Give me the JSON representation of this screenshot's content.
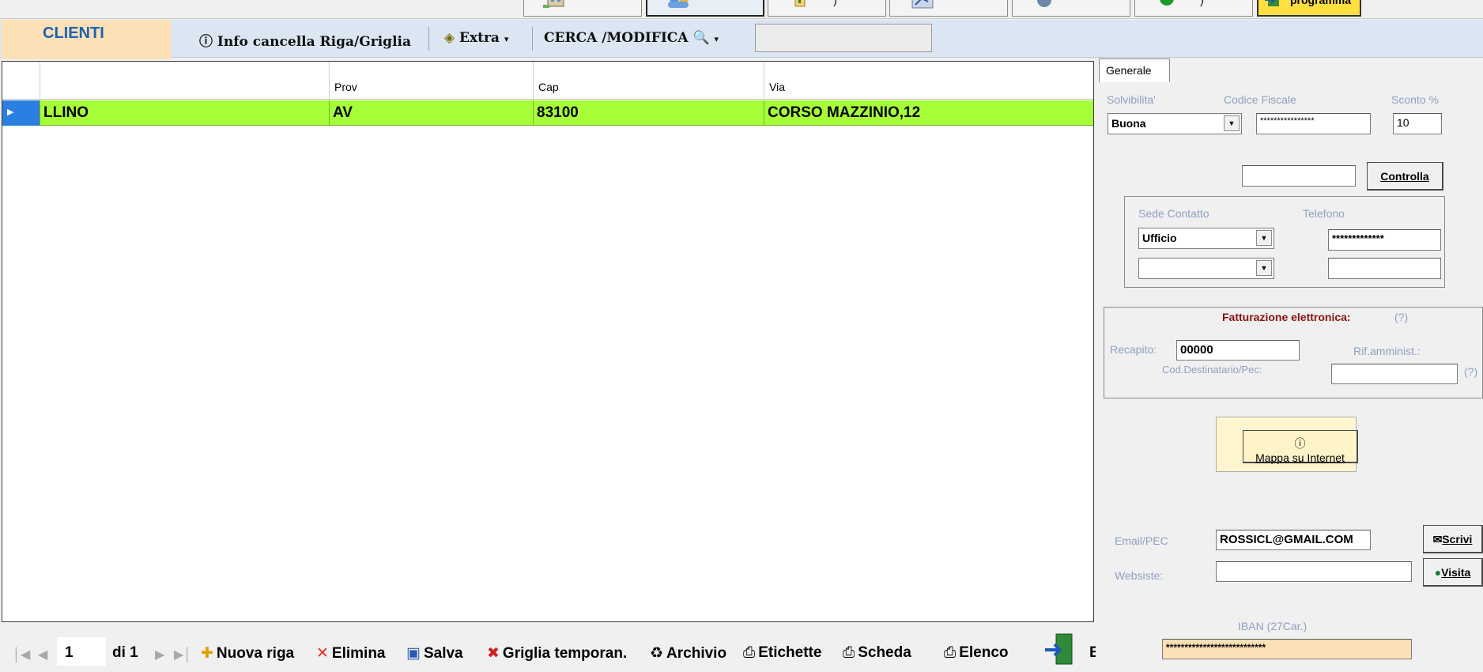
{
  "top_buttons": {
    "exit_label": "programma"
  },
  "toolbar": {
    "tab_label": "CLIENTI",
    "info_label": "Info cancella Riga/Griglia",
    "extra_label": "Extra",
    "search_label": "CERCA /MODIFICA",
    "search_value": ""
  },
  "grid": {
    "columns": [
      "",
      "Prov",
      "Cap",
      "Via"
    ],
    "rows": [
      {
        "name": "LLINO",
        "prov": "AV",
        "cap": "83100",
        "via": "CORSO MAZZINIO,12"
      }
    ]
  },
  "bottom_bar": {
    "position": "1",
    "of_label": "di 1",
    "new_row": "Nuova riga",
    "delete": "Elimina",
    "save": "Salva",
    "temp_grid": "Griglia temporan.",
    "archive": "Archivio",
    "labels": "Etichette",
    "card": "Scheda",
    "list": "Elenco",
    "exit": "Esci"
  },
  "panel": {
    "tab": "Generale",
    "solvibilita_label": "Solvibilita'",
    "solvibilita_value": "Buona",
    "codice_fiscale_label": "Codice Fiscale",
    "codice_fiscale_value": "****************",
    "sconto_label": "Sconto %",
    "sconto_value": "10",
    "controlla_label": "Controlla",
    "sede_contatto_label": "Sede Contatto",
    "sede_value": "Ufficio",
    "telefono_label": "Telefono",
    "telefono_value": "*************",
    "fatturazione_label": "Fatturazione elettronica:",
    "help_q": "(?)",
    "recapito_label": "Recapito:",
    "recapito_value": "00000",
    "rif_label": "Rif.amminist.:",
    "cod_dest_label": "Cod.Destinatario/Pec:",
    "mappa_label": "Mappa su Internet",
    "email_label": "Email/PEC",
    "email_value": "ROSSICL@GMAIL.COM",
    "scrivi_label": "Scrivi",
    "website_label": "Websiste:",
    "visita_label": "Visita",
    "iban_label": "IBAN (27Car.)",
    "iban_value": "***************************"
  }
}
